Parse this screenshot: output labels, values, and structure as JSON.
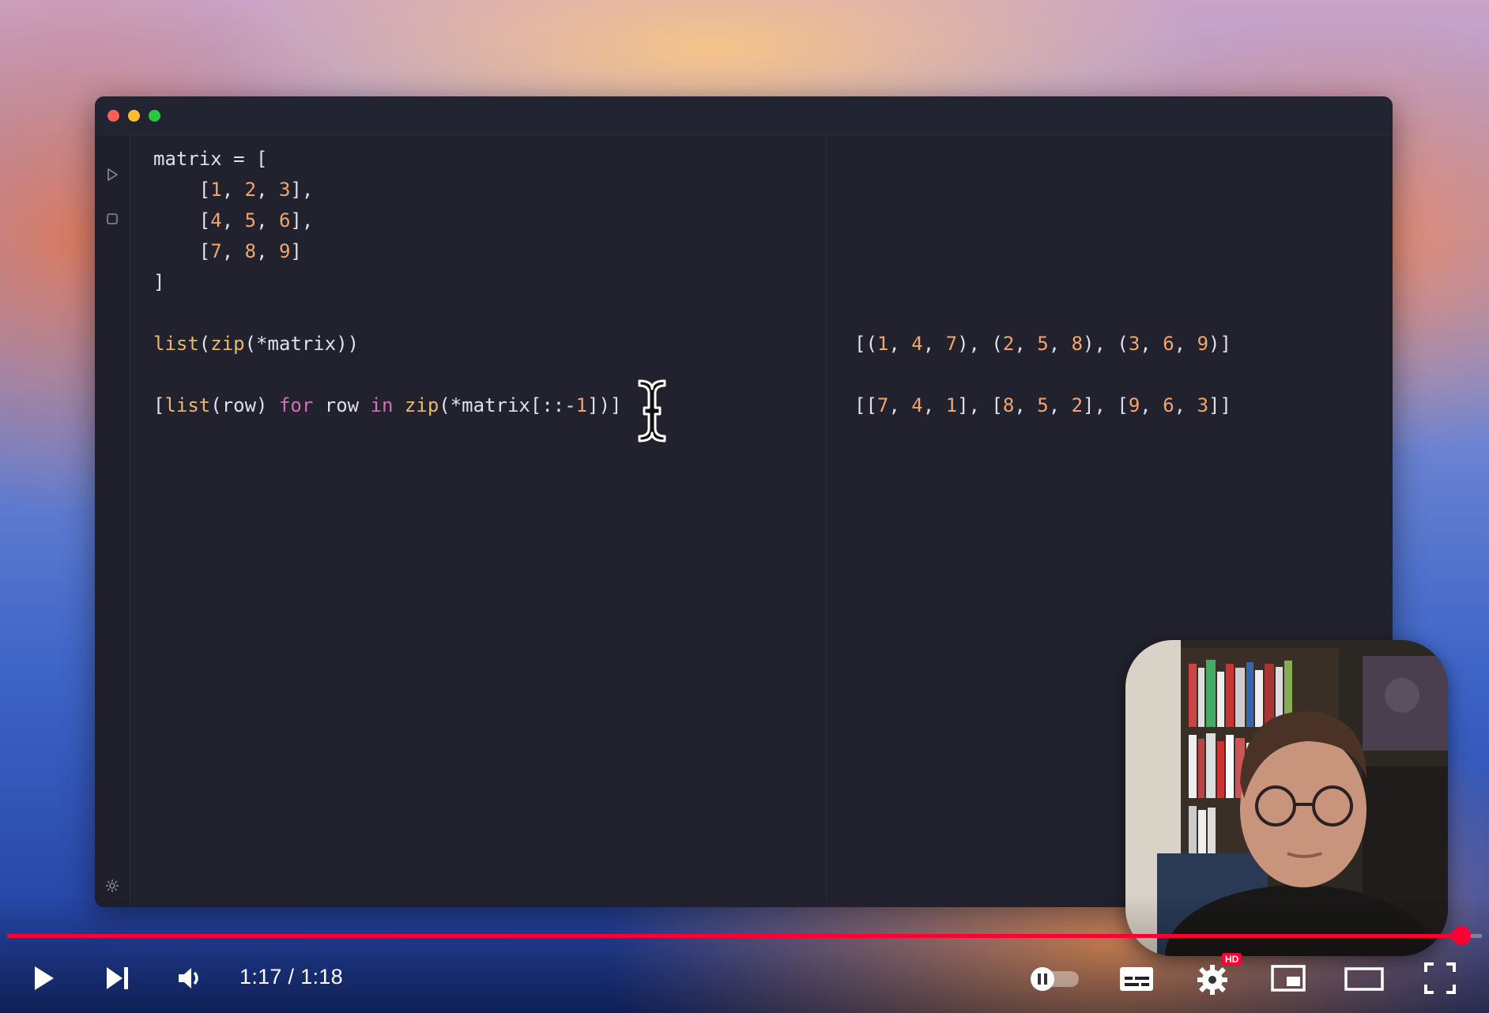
{
  "editor": {
    "lines": [
      [
        {
          "t": "matrix = [",
          "c": ""
        }
      ],
      [
        {
          "t": "    [",
          "c": ""
        },
        {
          "t": "1",
          "c": "num"
        },
        {
          "t": ", ",
          "c": ""
        },
        {
          "t": "2",
          "c": "num"
        },
        {
          "t": ", ",
          "c": ""
        },
        {
          "t": "3",
          "c": "num"
        },
        {
          "t": "],",
          "c": ""
        }
      ],
      [
        {
          "t": "    [",
          "c": ""
        },
        {
          "t": "4",
          "c": "num"
        },
        {
          "t": ", ",
          "c": ""
        },
        {
          "t": "5",
          "c": "num"
        },
        {
          "t": ", ",
          "c": ""
        },
        {
          "t": "6",
          "c": "num"
        },
        {
          "t": "],",
          "c": ""
        }
      ],
      [
        {
          "t": "    [",
          "c": ""
        },
        {
          "t": "7",
          "c": "num"
        },
        {
          "t": ", ",
          "c": ""
        },
        {
          "t": "8",
          "c": "num"
        },
        {
          "t": ", ",
          "c": ""
        },
        {
          "t": "9",
          "c": "num"
        },
        {
          "t": "]",
          "c": ""
        }
      ],
      [
        {
          "t": "]",
          "c": ""
        }
      ],
      [],
      [
        {
          "t": "list",
          "c": "fn"
        },
        {
          "t": "(",
          "c": ""
        },
        {
          "t": "zip",
          "c": "fn"
        },
        {
          "t": "(*matrix))",
          "c": ""
        }
      ],
      [],
      [
        {
          "t": "[",
          "c": ""
        },
        {
          "t": "list",
          "c": "fn"
        },
        {
          "t": "(row) ",
          "c": ""
        },
        {
          "t": "for",
          "c": "kw"
        },
        {
          "t": " row ",
          "c": ""
        },
        {
          "t": "in",
          "c": "kw"
        },
        {
          "t": " ",
          "c": ""
        },
        {
          "t": "zip",
          "c": "fn"
        },
        {
          "t": "(*matrix[::-",
          "c": ""
        },
        {
          "t": "1",
          "c": "num"
        },
        {
          "t": "])]",
          "c": ""
        }
      ]
    ]
  },
  "results": {
    "lines": [
      [],
      [],
      [],
      [],
      [],
      [],
      [
        {
          "t": "[(",
          "c": ""
        },
        {
          "t": "1",
          "c": "num"
        },
        {
          "t": ", ",
          "c": ""
        },
        {
          "t": "4",
          "c": "num"
        },
        {
          "t": ", ",
          "c": ""
        },
        {
          "t": "7",
          "c": "num"
        },
        {
          "t": "), (",
          "c": ""
        },
        {
          "t": "2",
          "c": "num"
        },
        {
          "t": ", ",
          "c": ""
        },
        {
          "t": "5",
          "c": "num"
        },
        {
          "t": ", ",
          "c": ""
        },
        {
          "t": "8",
          "c": "num"
        },
        {
          "t": "), (",
          "c": ""
        },
        {
          "t": "3",
          "c": "num"
        },
        {
          "t": ", ",
          "c": ""
        },
        {
          "t": "6",
          "c": "num"
        },
        {
          "t": ", ",
          "c": ""
        },
        {
          "t": "9",
          "c": "num"
        },
        {
          "t": ")]",
          "c": ""
        }
      ],
      [],
      [
        {
          "t": "[[",
          "c": ""
        },
        {
          "t": "7",
          "c": "num"
        },
        {
          "t": ", ",
          "c": ""
        },
        {
          "t": "4",
          "c": "num"
        },
        {
          "t": ", ",
          "c": ""
        },
        {
          "t": "1",
          "c": "num"
        },
        {
          "t": "], [",
          "c": ""
        },
        {
          "t": "8",
          "c": "num"
        },
        {
          "t": ", ",
          "c": ""
        },
        {
          "t": "5",
          "c": "num"
        },
        {
          "t": ", ",
          "c": ""
        },
        {
          "t": "2",
          "c": "num"
        },
        {
          "t": "], [",
          "c": ""
        },
        {
          "t": "9",
          "c": "num"
        },
        {
          "t": ", ",
          "c": ""
        },
        {
          "t": "6",
          "c": "num"
        },
        {
          "t": ", ",
          "c": ""
        },
        {
          "t": "3",
          "c": "num"
        },
        {
          "t": "]]",
          "c": ""
        }
      ]
    ]
  },
  "player": {
    "current_time": "1:17",
    "separator": " / ",
    "duration": "1:18",
    "progress_fraction": 0.986,
    "hd_badge": "HD",
    "accent_color": "#ff0033"
  },
  "icons": [
    "run-icon",
    "stop-icon",
    "settings-gear-icon",
    "play-icon",
    "next-icon",
    "volume-icon",
    "autoplay-toggle-icon",
    "subtitles-icon",
    "settings-icon",
    "miniplayer-icon",
    "theater-icon",
    "fullscreen-icon"
  ]
}
